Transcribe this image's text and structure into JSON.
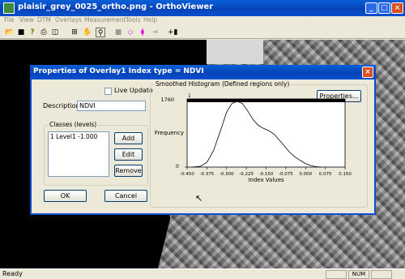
{
  "app": {
    "title": "plaisir_grey_0025_ortho.png - OrthoViewer"
  },
  "window_buttons": {
    "minimize": "_",
    "maximize": "□",
    "close": "×"
  },
  "menu": [
    "File",
    "View",
    "DTM",
    "Overlays",
    "Measurement",
    "Tools",
    "Help"
  ],
  "toolbar_icons": [
    "open-icon",
    "save-icon",
    "help-icon",
    "print-icon",
    "print-preview-icon",
    "grid-icon",
    "hand-icon",
    "zoom-icon",
    "stop-icon",
    "diamond-icon",
    "diamond-cross-icon",
    "arrow-icon",
    "plus-icon"
  ],
  "status": {
    "text": "Ready",
    "num": "NUM"
  },
  "dialog": {
    "title": "Properties of Overlay1     Index type = NDVI",
    "close": "×",
    "live_update_label": "Live Update",
    "live_update_checked": false,
    "description_label": "Description:",
    "description_value": "NDVI",
    "classes_label": "Classes (levels)",
    "classes": [
      {
        "text": "1  Level1   -1.000"
      }
    ],
    "add_label": "Add",
    "edit_label": "Edit",
    "remove_label": "Remove",
    "ok_label": "OK",
    "cancel_label": "Cancel",
    "histogram_group_label": "Smoothed Histogram (Defined regions only)",
    "properties_label": "Properties..."
  },
  "chart_data": {
    "type": "area",
    "title": "",
    "xlabel": "Index Values",
    "ylabel": "Frequency",
    "xlim": [
      -0.45,
      0.15
    ],
    "ylim": [
      0,
      1760
    ],
    "y_ticks": [
      "0",
      "1760"
    ],
    "x_ticks": [
      "-0.450",
      "-0.375",
      "-0.300",
      "-0.225",
      "-0.150",
      "-0.075",
      "0.000",
      "0.075",
      "0.150"
    ],
    "top_marker_label": "1",
    "series": [
      {
        "x": [
          -0.43,
          -0.4,
          -0.375,
          -0.35,
          -0.325,
          -0.3,
          -0.28,
          -0.26,
          -0.24,
          -0.22,
          -0.2,
          -0.18,
          -0.16,
          -0.14,
          -0.12,
          -0.1,
          -0.08,
          -0.06,
          -0.04,
          -0.02,
          0.0,
          0.02,
          0.04,
          0.06
        ],
        "values": [
          0,
          20,
          120,
          420,
          900,
          1420,
          1640,
          1700,
          1640,
          1450,
          1230,
          1080,
          1000,
          940,
          850,
          700,
          540,
          380,
          260,
          170,
          90,
          40,
          10,
          0
        ]
      }
    ]
  }
}
